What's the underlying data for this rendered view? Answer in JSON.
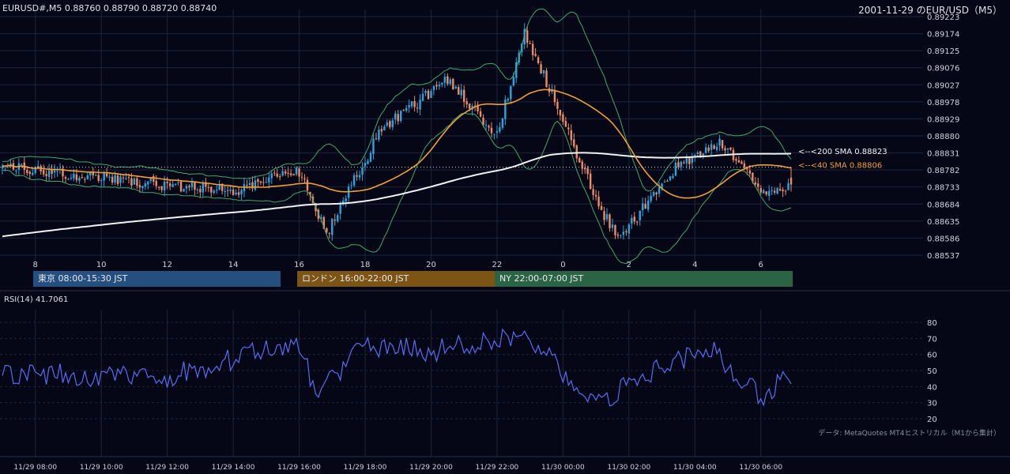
{
  "header": {
    "symbol_ohlc": "EURUSD#,M5 0.88760 0.88790 0.88720 0.88740",
    "date_title": "2001-11-29 のEUR/USD（M5）"
  },
  "colors": {
    "background": "#050716",
    "grid": "#20243a",
    "bull": "#2aa4e0",
    "bear": "#ee8a66",
    "sma200": "#f2f2f2",
    "sma40": "#f0a030",
    "bollinger": "#3fa86a",
    "rsi": "#5a6cf0",
    "session_tokyo": "#254f7e",
    "session_london": "#7c5414",
    "session_ny": "#2a6444"
  },
  "price_axis": {
    "ticks": [
      "0.89223",
      "0.89174",
      "0.89125",
      "0.89076",
      "0.89027",
      "0.88978",
      "0.88929",
      "0.88880",
      "0.88831",
      "0.88782",
      "0.88733",
      "0.88684",
      "0.88635",
      "0.88586",
      "0.88537"
    ]
  },
  "hour_axis": {
    "ticks": [
      "8",
      "10",
      "12",
      "14",
      "16",
      "18",
      "20",
      "22",
      "0",
      "2",
      "4",
      "6"
    ]
  },
  "ma_labels": {
    "sma200": "<--<200 SMA 0.88823",
    "sma40": "<--<40 SMA 0.88806"
  },
  "sessions": [
    {
      "label": "東京 08:00-15:30 JST"
    },
    {
      "label": "ロンドン 16:00-22:00 JST"
    },
    {
      "label": "NY 22:00-07:00 JST"
    }
  ],
  "rsi": {
    "title": "RSI(14) 41.7061",
    "ticks": [
      "80",
      "70",
      "60",
      "50",
      "40",
      "30",
      "20"
    ]
  },
  "credit": "データ: MetaQuotes MT4ヒストリカル（M1から集計）",
  "time_axis": {
    "ticks": [
      "11/29 08:00",
      "11/29 10:00",
      "11/29 12:00",
      "11/29 14:00",
      "11/29 16:00",
      "11/29 18:00",
      "11/29 20:00",
      "11/29 22:00",
      "11/30 00:00",
      "11/30 02:00",
      "11/30 04:00",
      "11/30 06:00"
    ]
  },
  "chart_data": [
    {
      "type": "candlestick",
      "title": "EURUSD#,M5",
      "y_range": [
        0.88537,
        0.89223
      ],
      "time_range": [
        "2001-11-29 07:00",
        "2001-11-30 06:55"
      ],
      "last": {
        "open": 0.8876,
        "high": 0.8879,
        "low": 0.8872,
        "close": 0.8874
      },
      "indicators": [
        {
          "name": "200 SMA",
          "last_value": 0.88823
        },
        {
          "name": "40 SMA",
          "last_value": 0.88806
        }
      ],
      "approx_close_path": [
        {
          "time": "07:00",
          "close": 0.8879
        },
        {
          "time": "09:00",
          "close": 0.8877
        },
        {
          "time": "12:00",
          "close": 0.8874
        },
        {
          "time": "14:00",
          "close": 0.8872
        },
        {
          "time": "16:00",
          "close": 0.8878
        },
        {
          "time": "16:50",
          "close": 0.886
        },
        {
          "time": "18:30",
          "close": 0.889
        },
        {
          "time": "20:30",
          "close": 0.8904
        },
        {
          "time": "22:00",
          "close": 0.8888
        },
        {
          "time": "22:50",
          "close": 0.8918
        },
        {
          "time": "23:40",
          "close": 0.89
        },
        {
          "time": "01:00",
          "close": 0.887
        },
        {
          "time": "01:40",
          "close": 0.8858
        },
        {
          "time": "03:30",
          "close": 0.888
        },
        {
          "time": "04:50",
          "close": 0.8886
        },
        {
          "time": "06:00",
          "close": 0.8872
        },
        {
          "time": "06:55",
          "close": 0.8874
        }
      ]
    },
    {
      "type": "line",
      "title": "RSI(14)",
      "ylim": [
        20,
        80
      ],
      "last_value": 41.7061,
      "approx_path": [
        {
          "time": "07:00",
          "value": 48
        },
        {
          "time": "12:00",
          "value": 46
        },
        {
          "time": "16:00",
          "value": 68
        },
        {
          "time": "16:30",
          "value": 33
        },
        {
          "time": "18:00",
          "value": 66
        },
        {
          "time": "20:00",
          "value": 62
        },
        {
          "time": "22:50",
          "value": 72
        },
        {
          "time": "00:30",
          "value": 40
        },
        {
          "time": "01:10",
          "value": 30
        },
        {
          "time": "02:30",
          "value": 48
        },
        {
          "time": "04:30",
          "value": 63
        },
        {
          "time": "06:10",
          "value": 31
        },
        {
          "time": "06:40",
          "value": 50
        },
        {
          "time": "06:55",
          "value": 42
        }
      ]
    }
  ]
}
